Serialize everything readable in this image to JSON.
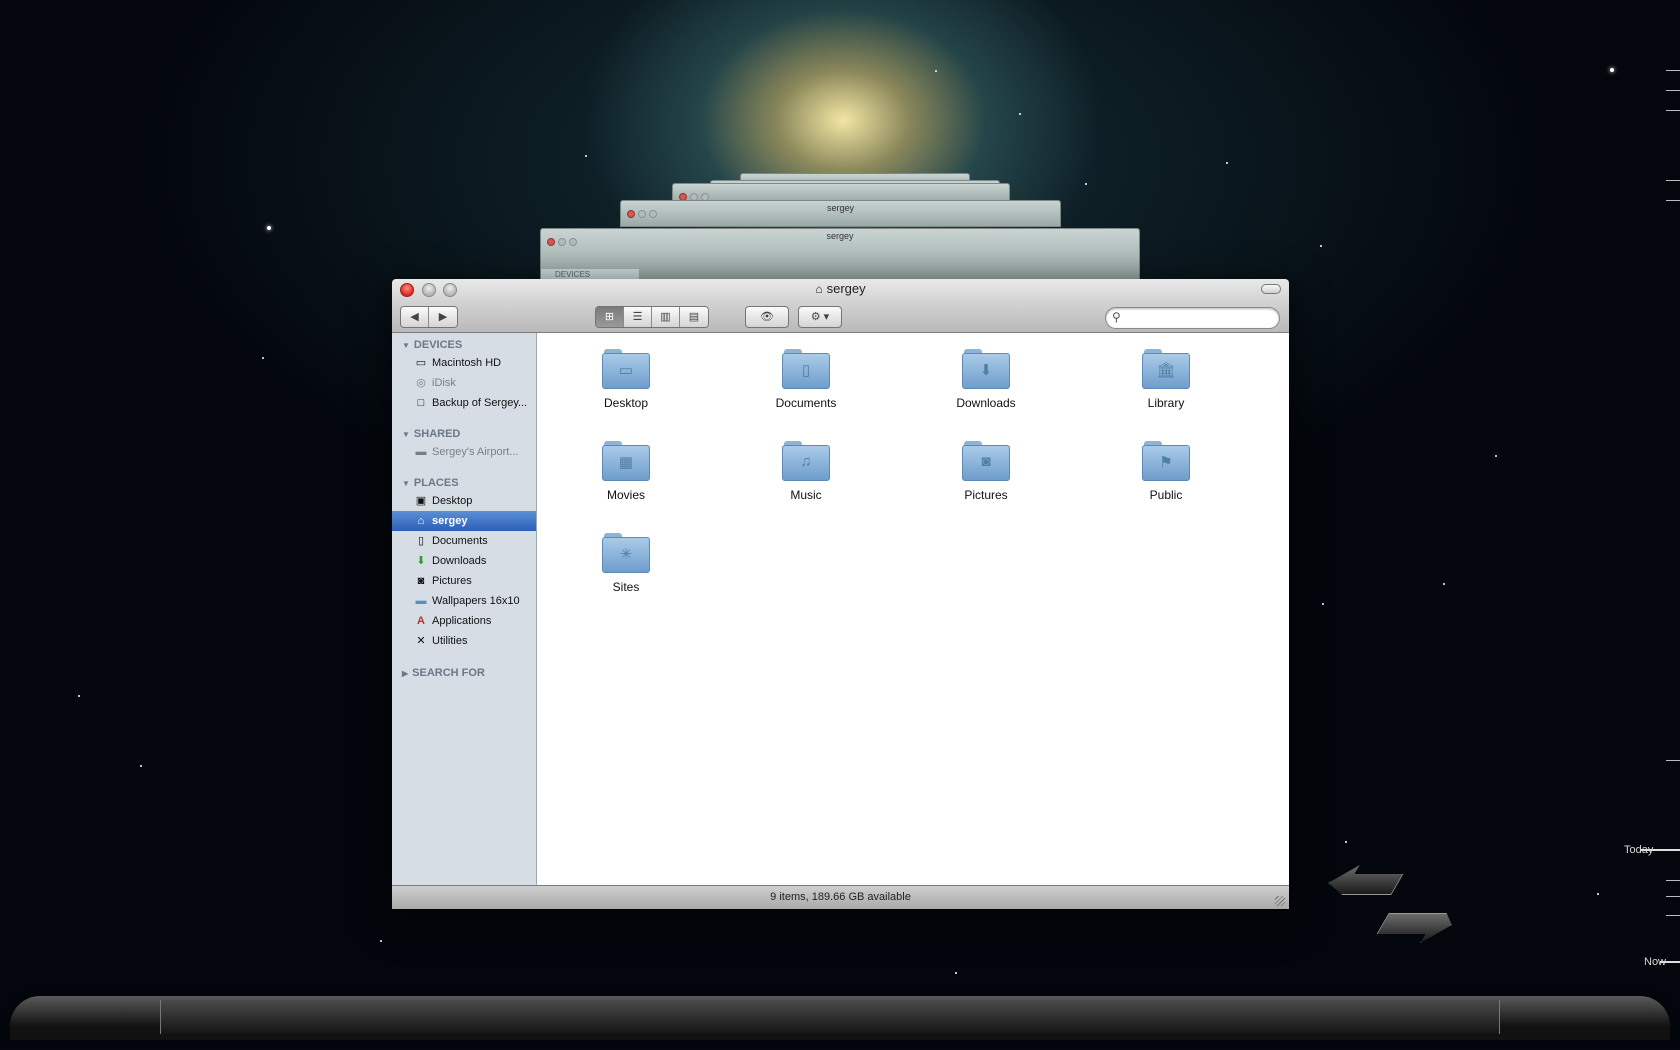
{
  "window": {
    "title": "sergey",
    "status": "9 items, 189.66 GB available"
  },
  "stack": {
    "title": "sergey",
    "devices_label": "DEVICES"
  },
  "toolbar": {
    "back_glyph": "◀",
    "forward_glyph": "▶",
    "view_icons": [
      "icon-view-icon",
      "list-view-icon",
      "column-view-icon",
      "coverflow-view-icon"
    ],
    "quicklook_glyph": "👁",
    "action_glyph": "⚙ ▾",
    "search_placeholder": ""
  },
  "sidebar": {
    "devices_header": "DEVICES",
    "devices": [
      {
        "label": "Macintosh HD",
        "icon": "hard-drive-icon",
        "glyph": "▭"
      },
      {
        "label": "iDisk",
        "icon": "idisk-icon",
        "glyph": "◎"
      },
      {
        "label": "Backup of Sergey...",
        "icon": "backup-disk-icon",
        "glyph": "□"
      }
    ],
    "shared_header": "SHARED",
    "shared": [
      {
        "label": "Sergey's Airport...",
        "icon": "airport-disk-icon",
        "glyph": "▬"
      }
    ],
    "places_header": "PLACES",
    "places": [
      {
        "label": "Desktop",
        "icon": "desktop-icon",
        "glyph": "▣"
      },
      {
        "label": "sergey",
        "icon": "home-icon",
        "glyph": "⌂"
      },
      {
        "label": "Documents",
        "icon": "document-icon",
        "glyph": "▯"
      },
      {
        "label": "Downloads",
        "icon": "downloads-icon",
        "glyph": "⬇"
      },
      {
        "label": "Pictures",
        "icon": "pictures-icon",
        "glyph": "◙"
      },
      {
        "label": "Wallpapers 16x10",
        "icon": "folder-icon",
        "glyph": "▬"
      },
      {
        "label": "Applications",
        "icon": "applications-icon",
        "glyph": "A"
      },
      {
        "label": "Utilities",
        "icon": "utilities-icon",
        "glyph": "✕"
      }
    ],
    "search_header": "SEARCH FOR"
  },
  "folders": [
    {
      "label": "Desktop",
      "emblem": "▭"
    },
    {
      "label": "Documents",
      "emblem": "▯"
    },
    {
      "label": "Downloads",
      "emblem": "⬇"
    },
    {
      "label": "Library",
      "emblem": "🏛"
    },
    {
      "label": "Movies",
      "emblem": "▦"
    },
    {
      "label": "Music",
      "emblem": "♫"
    },
    {
      "label": "Pictures",
      "emblem": "◙"
    },
    {
      "label": "Public",
      "emblem": "⚑"
    },
    {
      "label": "Sites",
      "emblem": "✳"
    }
  ],
  "timeline": {
    "today": "Today",
    "now": "Now"
  }
}
